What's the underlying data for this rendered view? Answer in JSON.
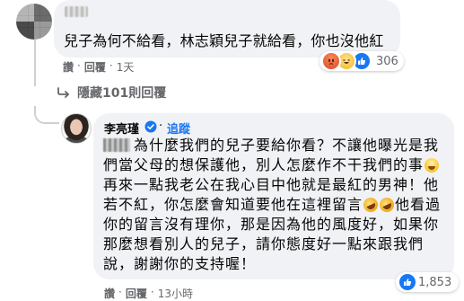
{
  "comment": {
    "text": "兒子為何不給看，林志穎兒子就給看，你也沒他紅",
    "reactions": {
      "icons": [
        "angry-reaction-icon",
        "haha-reaction-icon",
        "like-reaction-icon"
      ],
      "count": "306"
    },
    "actions": {
      "like": "讚",
      "sep1": "·",
      "reply": "回覆",
      "sep2": "·",
      "time": "1天"
    }
  },
  "hidden_replies": {
    "label": "隱藏101則回覆",
    "icon": "reply-arrow-icon"
  },
  "reply": {
    "author": "李亮瑾",
    "verified_icon": "verified-badge-icon",
    "separator": "·",
    "follow": "追蹤",
    "lines": [
      "為什麼我們的兒子要給你看？不讓他曝光是我",
      "們當父母的想保護他，別人怎麼作不干我們的事",
      "再來一點我老公在我心目中他就是最紅的男神！他",
      "若不紅，你怎麼會知道要他在這裡留言",
      "他看過",
      "你的留言沒有理你，那是因為他的風度好，如果你",
      "那麼想看別人的兒子，請你態度好一點來跟我們",
      "說，謝謝你的支持喔！"
    ],
    "reactions": {
      "icons": [
        "like-reaction-icon"
      ],
      "count": "1,853"
    },
    "actions": {
      "like": "讚",
      "sep1": "·",
      "reply": "回覆",
      "sep2": "·",
      "time": "13小時"
    }
  },
  "colors": {
    "bubble": "#f0f2f5",
    "link": "#1877f2",
    "meta": "#65676b",
    "thread_line": "#ced0d4"
  }
}
